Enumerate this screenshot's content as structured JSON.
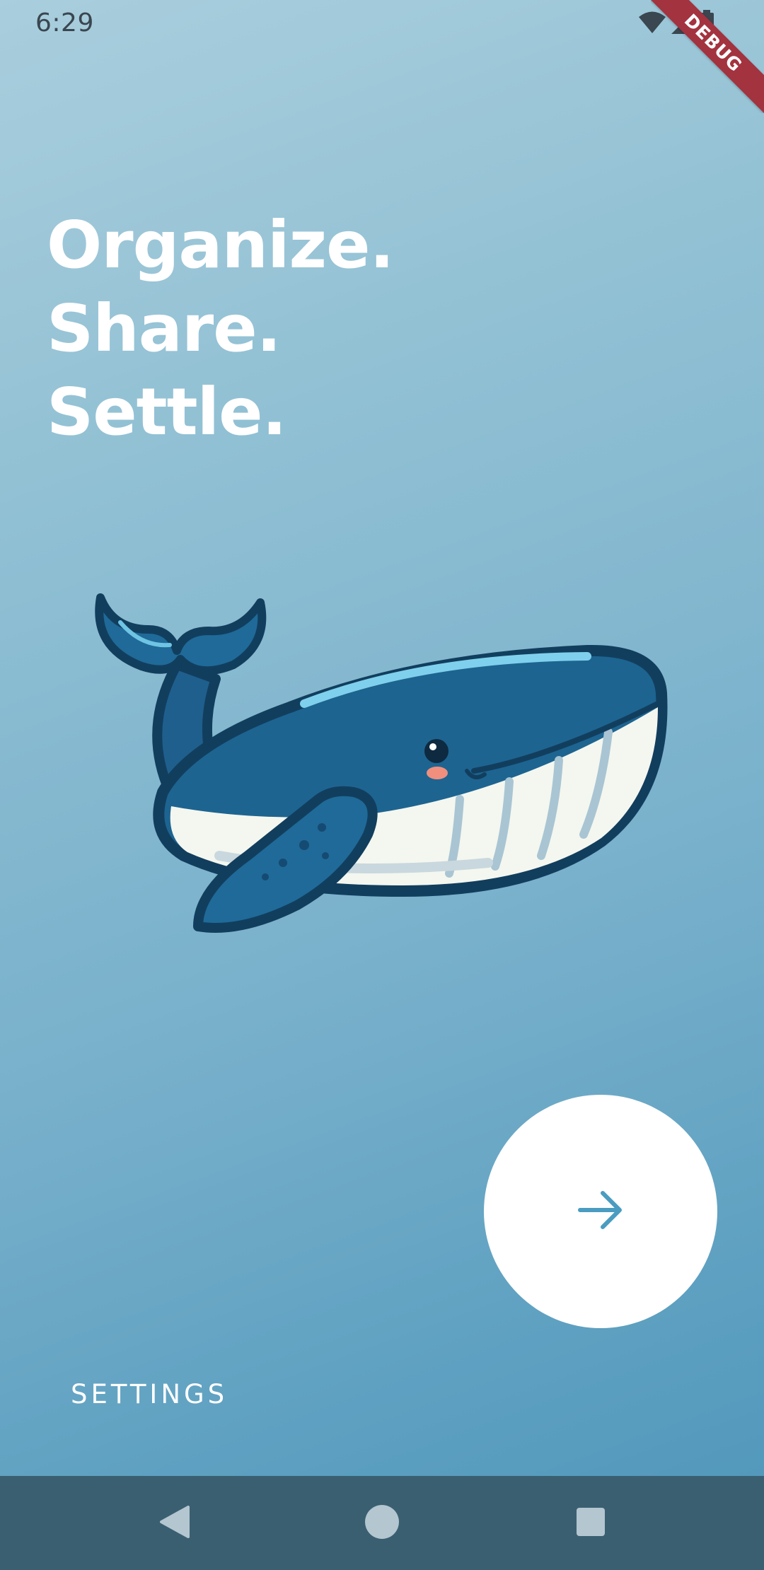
{
  "status_bar": {
    "time": "6:29",
    "icons": [
      "wifi-icon",
      "signal-icon",
      "battery-icon"
    ]
  },
  "debug_banner": {
    "label": "DEBUG",
    "color": "#a3333f"
  },
  "headline": {
    "lines": [
      "Organize.",
      "Share.",
      "Settle."
    ]
  },
  "illustration": {
    "subject": "whale-illustration"
  },
  "next_button": {
    "icon": "arrow-right-icon",
    "icon_color": "#4a9cc0"
  },
  "settings": {
    "label": "SETTINGS"
  },
  "navigation_bar": {
    "buttons": [
      "back-icon",
      "home-icon",
      "recents-icon"
    ]
  },
  "colors": {
    "background_top": "#a9cedd",
    "background_bottom": "#4f96ba",
    "nav_bar": "#3a5f71",
    "accent": "#4a9cc0"
  }
}
